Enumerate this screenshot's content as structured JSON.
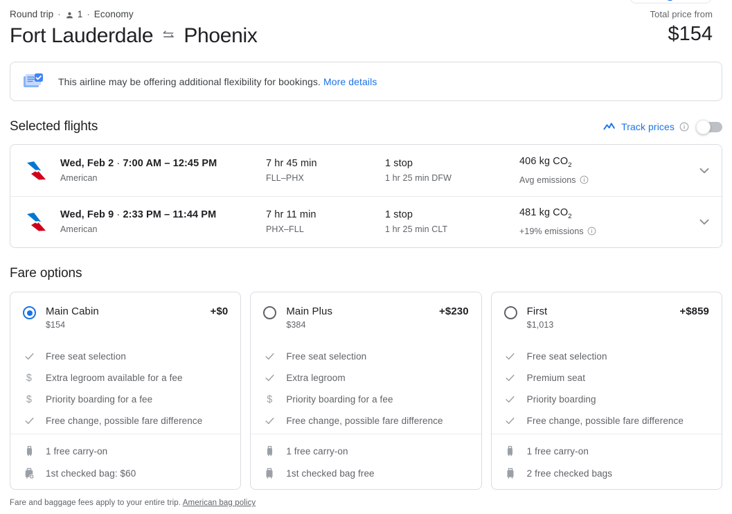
{
  "header": {
    "trip_type": "Round trip",
    "separator": "·",
    "passengers": "1",
    "cabin_class": "Economy",
    "origin": "Fort Lauderdale",
    "destination": "Phoenix",
    "price_label": "Total price from",
    "price_value": "$154"
  },
  "banner": {
    "text": "This airline may be offering additional flexibility for bookings.",
    "link": "More details"
  },
  "selected_flights": {
    "title": "Selected flights",
    "track_prices_label": "Track prices",
    "toggle_state": "off",
    "rows": [
      {
        "airline": "American",
        "date_times": "Wed, Feb 2  ·  7:00 AM – 12:45 PM",
        "date": "Wed, Feb 2",
        "times": "7:00 AM – 12:45 PM",
        "duration": "7 hr 45 min",
        "route": "FLL–PHX",
        "stops": "1 stop",
        "layover": "1 hr 25 min DFW",
        "emissions": "406 kg CO",
        "emissions_sub": "2",
        "emissions_note": "Avg emissions"
      },
      {
        "airline": "American",
        "date_times": "Wed, Feb 9  ·  2:33 PM – 11:44 PM",
        "date": "Wed, Feb 9",
        "times": "2:33 PM – 11:44 PM",
        "duration": "7 hr 11 min",
        "route": "PHX–FLL",
        "stops": "1 stop",
        "layover": "1 hr 25 min CLT",
        "emissions": "481 kg CO",
        "emissions_sub": "2",
        "emissions_note": "+19% emissions"
      }
    ]
  },
  "fare_options": {
    "title": "Fare options",
    "cards": [
      {
        "name": "Main Cabin",
        "base_price": "$154",
        "delta": "+$0",
        "selected": true,
        "features": [
          {
            "icon": "check",
            "label": "Free seat selection"
          },
          {
            "icon": "money",
            "label": "Extra legroom available for a fee"
          },
          {
            "icon": "money",
            "label": "Priority boarding for a fee"
          },
          {
            "icon": "check",
            "label": "Free change, possible fare difference"
          }
        ],
        "bags": [
          {
            "icon": "carry-on",
            "label": "1 free carry-on"
          },
          {
            "icon": "checked-bag-fee",
            "label": "1st checked bag: $60"
          }
        ]
      },
      {
        "name": "Main Plus",
        "base_price": "$384",
        "delta": "+$230",
        "selected": false,
        "features": [
          {
            "icon": "check",
            "label": "Free seat selection"
          },
          {
            "icon": "check",
            "label": "Extra legroom"
          },
          {
            "icon": "money",
            "label": "Priority boarding for a fee"
          },
          {
            "icon": "check",
            "label": "Free change, possible fare difference"
          }
        ],
        "bags": [
          {
            "icon": "carry-on",
            "label": "1 free carry-on"
          },
          {
            "icon": "checked-bag",
            "label": "1st checked bag free"
          }
        ]
      },
      {
        "name": "First",
        "base_price": "$1,013",
        "delta": "+$859",
        "selected": false,
        "features": [
          {
            "icon": "check",
            "label": "Free seat selection"
          },
          {
            "icon": "check",
            "label": "Premium seat"
          },
          {
            "icon": "check",
            "label": "Priority boarding"
          },
          {
            "icon": "check",
            "label": "Free change, possible fare difference"
          }
        ],
        "bags": [
          {
            "icon": "carry-on",
            "label": "1 free carry-on"
          },
          {
            "icon": "checked-bag",
            "label": "2 free checked bags"
          }
        ]
      }
    ]
  },
  "footer": {
    "text": "Fare and baggage fees apply to your entire trip.",
    "link": "American bag policy"
  },
  "colors": {
    "accent_blue": "#1a73e8",
    "text_primary": "#202124",
    "text_secondary": "#5f6368",
    "border": "#dadce0",
    "aa_blue": "#0078d2",
    "aa_red": "#d0021b"
  }
}
